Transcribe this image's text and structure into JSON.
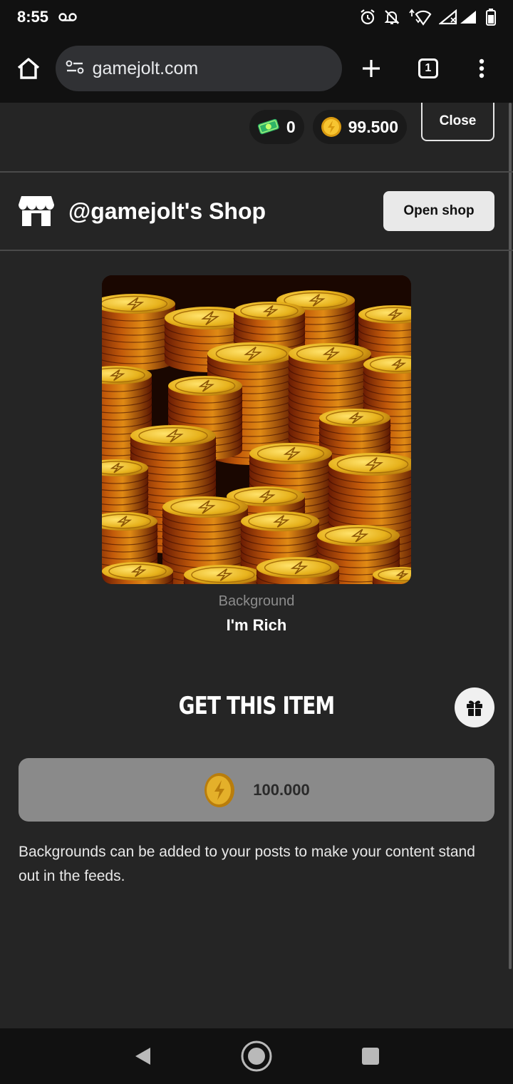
{
  "status_bar": {
    "time": "8:55",
    "icons": [
      "voicemail-icon",
      "alarm-icon",
      "notifications-off-icon",
      "wifi-icon",
      "signal-icon",
      "battery-icon"
    ]
  },
  "browser": {
    "url": "gamejolt.com",
    "tab_count": "1",
    "icons": [
      "home-icon",
      "site-settings-icon",
      "plus-icon",
      "tabs-icon",
      "more-vert-icon"
    ]
  },
  "wallet": {
    "joltbux": "0",
    "coins": "99.500",
    "close_label": "Close"
  },
  "shop": {
    "title": "@gamejolt's Shop",
    "open_label": "Open shop"
  },
  "item": {
    "type": "Background",
    "name": "I'm Rich"
  },
  "purchase": {
    "title": "GET THIS ITEM",
    "price": "100.000",
    "description": "Backgrounds can be added to your posts to make your content stand out in the feeds."
  },
  "colors": {
    "page_bg": "#252525",
    "bar_bg": "#111111",
    "price_button_bg": "#8a8a8a",
    "coin_gold": "#f2b51c"
  }
}
